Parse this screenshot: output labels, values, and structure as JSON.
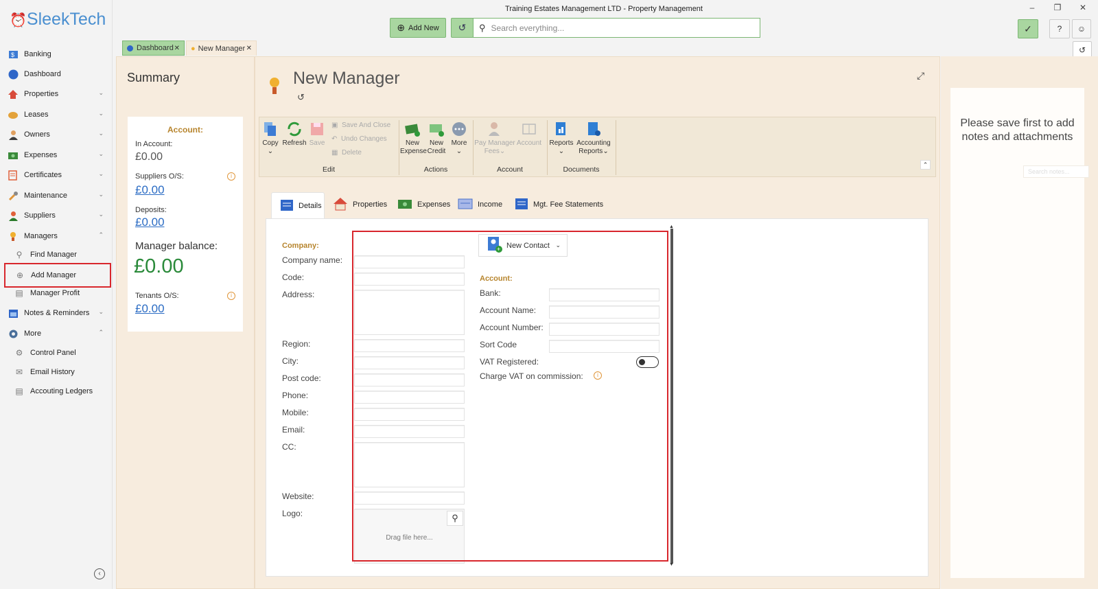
{
  "window": {
    "title": "Training Estates Management LTD - Property Management"
  },
  "brand": {
    "prefix": "⏰",
    "name": "SleekTech"
  },
  "topbar": {
    "add_new": "Add New",
    "search_placeholder": "Search everything..."
  },
  "sidebar": {
    "items": [
      {
        "label": "Banking"
      },
      {
        "label": "Dashboard"
      },
      {
        "label": "Properties"
      },
      {
        "label": "Leases"
      },
      {
        "label": "Owners"
      },
      {
        "label": "Expenses"
      },
      {
        "label": "Certificates"
      },
      {
        "label": "Maintenance"
      },
      {
        "label": "Suppliers"
      },
      {
        "label": "Managers"
      },
      {
        "label": "Notes & Reminders"
      },
      {
        "label": "More"
      }
    ],
    "managers_sub": [
      "Find Manager",
      "Add Manager",
      "Manager Profit"
    ],
    "more_sub": [
      "Control Panel",
      "Email History",
      "Accouting Ledgers"
    ]
  },
  "doc_tabs": [
    {
      "label": "Dashboard"
    },
    {
      "label": "New Manager"
    }
  ],
  "summary": {
    "title": "Summary",
    "account_heading": "Account:",
    "in_account_label": "In Account:",
    "in_account_value": "£0.00",
    "suppliers_label": "Suppliers O/S:",
    "suppliers_value": "£0.00",
    "deposits_label": "Deposits:",
    "deposits_value": "£0.00",
    "balance_label": "Manager balance:",
    "balance_value": "£0.00",
    "tenants_label": "Tenants O/S:",
    "tenants_value": "£0.00"
  },
  "page": {
    "title": "New Manager"
  },
  "ribbon": {
    "copy": "Copy",
    "refresh": "Refresh",
    "save": "Save",
    "save_and_close": "Save And Close",
    "undo_changes": "Undo Changes",
    "delete": "Delete",
    "new_expense_1": "New",
    "new_expense_2": "Expense",
    "new_credit_1": "New",
    "new_credit_2": "Credit",
    "more": "More",
    "pay_fees_1": "Pay Manager",
    "pay_fees_2": "Fees",
    "account": "Account",
    "reports": "Reports",
    "acc_reports_1": "Accounting",
    "acc_reports_2": "Reports",
    "groups": {
      "edit": "Edit",
      "actions": "Actions",
      "account": "Account",
      "documents": "Documents"
    }
  },
  "form_tabs": [
    "Details",
    "Properties",
    "Expenses",
    "Income",
    "Mgt. Fee Statements"
  ],
  "form": {
    "company_heading": "Company:",
    "company_name": "Company name:",
    "code": "Code:",
    "address": "Address:",
    "region": "Region:",
    "city": "City:",
    "post_code": "Post code:",
    "phone": "Phone:",
    "mobile": "Mobile:",
    "email": "Email:",
    "cc": "CC:",
    "website": "Website:",
    "logo": "Logo:",
    "drag": "Drag file here...",
    "new_contact": "New Contact",
    "account_heading": "Account:",
    "bank": "Bank:",
    "account_name": "Account Name:",
    "account_number": "Account Number:",
    "sort_code": "Sort Code",
    "vat_registered": "VAT Registered:",
    "charge_vat": "Charge VAT on commission:"
  },
  "notes": {
    "message": "Please save first to add notes and attachments",
    "search_placeholder": "Search notes..."
  },
  "colors": {
    "accent_green": "#a9d6a0",
    "panel_beige": "#f7ecde",
    "highlight_red": "#d8262c",
    "balance_green": "#2a8a3a",
    "link_blue": "#2b6cc4"
  }
}
